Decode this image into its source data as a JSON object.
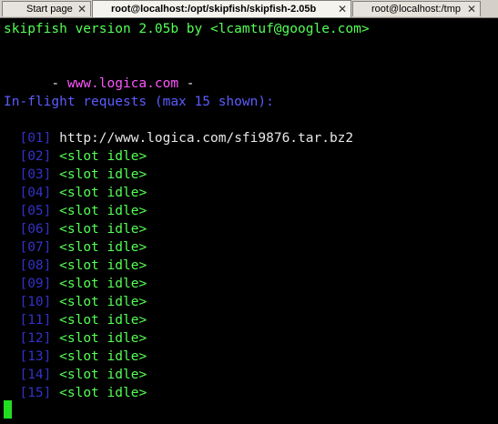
{
  "tabs": [
    {
      "label": "Start page",
      "close": "✕"
    },
    {
      "label": "root@localhost:/opt/skipfish/skipfish-2.05b",
      "close": "✕"
    },
    {
      "label": "root@localhost:/tmp",
      "close": "✕"
    }
  ],
  "terminal": {
    "banner": "skipfish version 2.05b by <lcamtuf@google.com>",
    "target_prefix": "  - ",
    "target_host": "www.logica.com",
    "target_suffix": " -",
    "inflight_heading": "In-flight requests (max 15 shown):",
    "slots": [
      {
        "num": "01",
        "status": "http://www.logica.com/sfi9876.tar.bz2"
      },
      {
        "num": "02",
        "status": "<slot idle>"
      },
      {
        "num": "03",
        "status": "<slot idle>"
      },
      {
        "num": "04",
        "status": "<slot idle>"
      },
      {
        "num": "05",
        "status": "<slot idle>"
      },
      {
        "num": "06",
        "status": "<slot idle>"
      },
      {
        "num": "07",
        "status": "<slot idle>"
      },
      {
        "num": "08",
        "status": "<slot idle>"
      },
      {
        "num": "09",
        "status": "<slot idle>"
      },
      {
        "num": "10",
        "status": "<slot idle>"
      },
      {
        "num": "11",
        "status": "<slot idle>"
      },
      {
        "num": "12",
        "status": "<slot idle>"
      },
      {
        "num": "13",
        "status": "<slot idle>"
      },
      {
        "num": "14",
        "status": "<slot idle>"
      },
      {
        "num": "15",
        "status": "<slot idle>"
      }
    ]
  },
  "colors": {
    "background": "#000000",
    "banner": "#54ff54",
    "host": "#ff55ff",
    "heading": "#5c5cff",
    "slot_bracket": "#3232c8",
    "url": "#e8e8e8",
    "idle": "#54ff54",
    "cursor": "#22dd22"
  }
}
